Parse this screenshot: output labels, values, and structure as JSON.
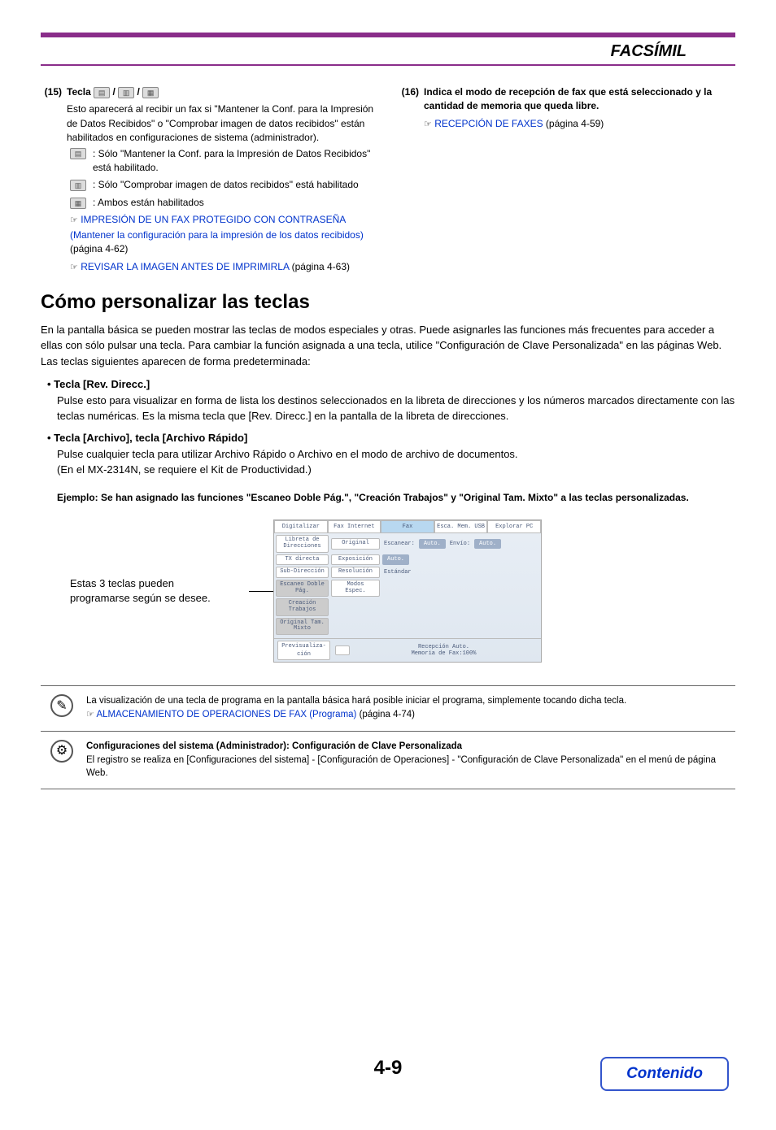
{
  "header": {
    "title": "FACSÍMIL"
  },
  "item15": {
    "num": "(15)",
    "label_prefix": "Tecla",
    "slash": " / ",
    "desc": "Esto aparecerá al recibir un fax si \"Mantener la Conf. para la Impresión de Datos Recibidos\" o \"Comprobar imagen de datos recibidos\" están habilitados en configuraciones de sistema (administrador).",
    "opt1": ": Sólo \"Mantener la Conf. para la Impresión de Datos Recibidos\" está habilitado.",
    "opt2": ": Sólo \"Comprobar imagen de datos recibidos\" está habilitado",
    "opt3": ": Ambos están habilitados",
    "link1": "IMPRESIÓN DE UN FAX PROTEGIDO CON CONTRASEÑA (Mantener la configuración para la impresión de los datos recibidos)",
    "link1_page": " (página 4-62)",
    "link2": "REVISAR LA IMAGEN ANTES DE IMPRIMIRLA",
    "link2_page": " (página 4-63)"
  },
  "item16": {
    "num": "(16)",
    "title": "Indica el modo de recepción de fax que está seleccionado y la cantidad de memoria que queda libre.",
    "link": "RECEPCIÓN DE FAXES",
    "link_page": " (página 4-59)"
  },
  "h2": "Cómo personalizar las teclas",
  "para1": "En la pantalla básica se pueden mostrar las teclas de modos especiales y otras. Puede asignarles las funciones más frecuentes para acceder a ellas con sólo pulsar una tecla. Para cambiar la función asignada a una tecla, utilice \"Configuración de Clave Personalizada\" en las páginas Web. Las teclas siguientes aparecen de forma predeterminada:",
  "bullet1": {
    "title": "• Tecla [Rev. Direcc.]",
    "body": "Pulse esto para visualizar en forma de lista los destinos seleccionados en la libreta de direcciones y los números marcados directamente con las teclas numéricas. Es la misma tecla que [Rev. Direcc.] en la pantalla de la libreta de direcciones."
  },
  "bullet2": {
    "title": "• Tecla [Archivo], tecla [Archivo Rápido]",
    "body1": "Pulse cualquier tecla para utilizar Archivo Rápido o Archivo en el modo de archivo de documentos.",
    "body2": "(En el MX-2314N, se requiere el Kit de Productividad.)"
  },
  "example": "Ejemplo: Se han asignado las funciones \"Escaneo Doble Pág.\", \"Creación Trabajos\" y \"Original Tam. Mixto\" a las teclas personalizadas.",
  "caption": {
    "line1": "Estas 3 teclas pueden",
    "line2": "programarse según se desee."
  },
  "screen": {
    "tabs": [
      "Digitalizar",
      "Fax Internet",
      "Fax",
      "Esca. Mem. USB",
      "Explorar PC"
    ],
    "btn_libreta": "Libreta de Direcciones",
    "btn_original": "Original",
    "lbl_escanear": "Escanear:",
    "auto1": "Auto.",
    "lbl_envio": "Envío:",
    "auto2": "Auto.",
    "btn_tx": "TX directa",
    "btn_expo": "Exposición",
    "auto3": "Auto.",
    "btn_subdir": "Sub-Dirección",
    "btn_resol": "Resolución",
    "lbl_estandar": "Estándar",
    "btn_esc_doble": "Escaneo Doble Pág.",
    "btn_modos": "Modos Espec.",
    "btn_creacion": "Creación Trabajos",
    "btn_origtam": "Original Tam. Mixto",
    "btn_prev": "Previsualiza-ción",
    "status1": "Recepción Auto.",
    "status2": "Memoria de Fax:100%"
  },
  "note1": {
    "text": "La visualización de una tecla de programa en la pantalla básica hará posible iniciar el programa, simplemente tocando dicha tecla.",
    "link": "ALMACENAMIENTO DE OPERACIONES DE FAX (Programa)",
    "link_page": " (página 4-74)"
  },
  "note2": {
    "title": "Configuraciones del sistema (Administrador): Configuración de Clave Personalizada",
    "body": "El registro se realiza en [Configuraciones del sistema] - [Configuración de Operaciones] - \"Configuración de Clave Personalizada\" en el menú de página Web."
  },
  "page_num": "4-9",
  "contenido": "Contenido"
}
